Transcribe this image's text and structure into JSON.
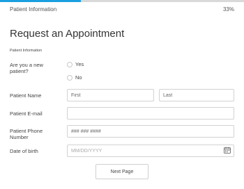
{
  "progress": {
    "label": "Patient Information",
    "percent_text": "33%",
    "fraction": 0.33,
    "fill_color": "#1aa0e0",
    "track_color": "#d9d9d9"
  },
  "page_title": "Request an Appointment",
  "section_title": "Patient Information",
  "new_patient": {
    "label": "Are you a new patient?",
    "options": [
      "Yes",
      "No"
    ]
  },
  "name": {
    "label": "Patient Name",
    "first_placeholder": "First",
    "last_placeholder": "Last"
  },
  "email": {
    "label": "Patient E-mail",
    "placeholder": ""
  },
  "phone": {
    "label": "Patient Phone Number",
    "placeholder": "### ### ####"
  },
  "dob": {
    "label": "Date of birth",
    "placeholder": "MM/DD/YYYY",
    "icon": "calendar-icon"
  },
  "next_button_label": "Next Page"
}
